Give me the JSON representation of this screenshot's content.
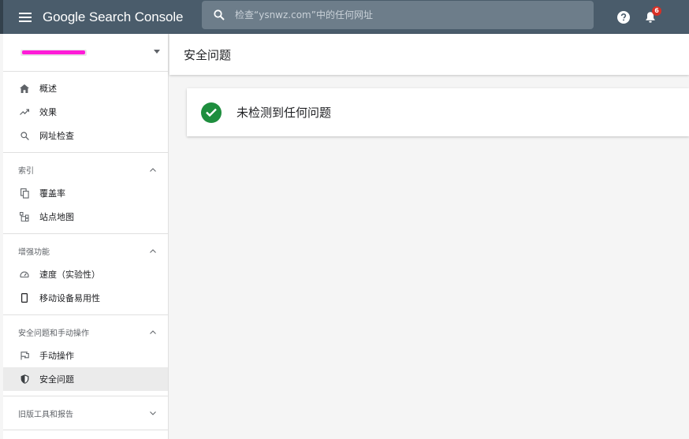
{
  "app": {
    "brand": "Google Search Console"
  },
  "search": {
    "placeholder": "检查“ysnwz.com”中的任何网址"
  },
  "notifications": {
    "count": "6"
  },
  "sidebar": {
    "property_name": "",
    "top_items": [
      {
        "label": "概述",
        "icon": "home-icon"
      },
      {
        "label": "效果",
        "icon": "trending-up-icon"
      },
      {
        "label": "网址检查",
        "icon": "search-icon"
      }
    ],
    "sections": [
      {
        "title": "索引",
        "expanded": true,
        "items": [
          {
            "label": "覆盖率",
            "icon": "copy-icon"
          },
          {
            "label": "站点地图",
            "icon": "sitemap-icon"
          }
        ]
      },
      {
        "title": "增强功能",
        "expanded": true,
        "items": [
          {
            "label": "速度（实验性）",
            "icon": "speed-icon"
          },
          {
            "label": "移动设备易用性",
            "icon": "mobile-icon"
          }
        ]
      },
      {
        "title": "安全问题和手动操作",
        "expanded": true,
        "items": [
          {
            "label": "手动操作",
            "icon": "flag-icon"
          },
          {
            "label": "安全问题",
            "icon": "shield-icon",
            "active": true
          }
        ]
      },
      {
        "title": "旧版工具和报告",
        "expanded": false,
        "items": []
      }
    ]
  },
  "main": {
    "page_title": "安全问题",
    "status_text": "未检测到任何问题"
  },
  "colors": {
    "topbar": "#4a5c6b",
    "success": "#1e8e3e",
    "badge": "#d93025",
    "property_mark": "#ff1bd8"
  }
}
